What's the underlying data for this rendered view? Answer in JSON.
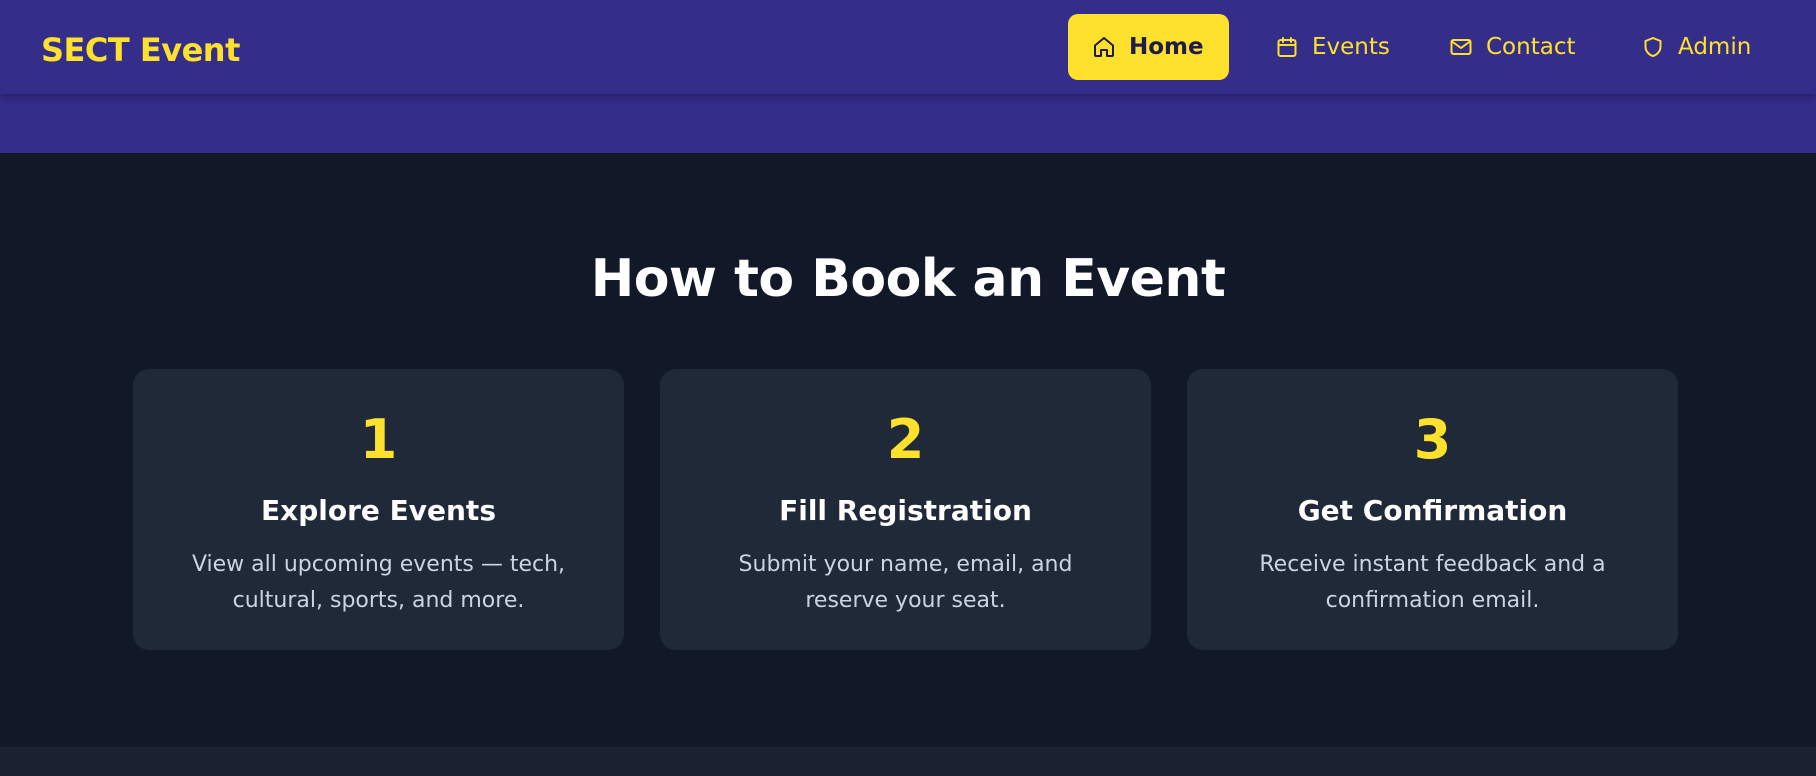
{
  "brand": {
    "name": "SECT Event",
    "color": "#fde12d"
  },
  "nav": {
    "items": [
      {
        "label": "Home",
        "icon": "home-icon",
        "active": true
      },
      {
        "label": "Events",
        "icon": "calendar-icon",
        "active": false
      },
      {
        "label": "Contact",
        "icon": "mail-icon",
        "active": false
      },
      {
        "label": "Admin",
        "icon": "shield-icon",
        "active": false
      }
    ]
  },
  "steps_section": {
    "title": "How to Book an Event",
    "steps": [
      {
        "number": "1",
        "title": "Explore Events",
        "description": "View all upcoming events — tech, cultural, sports, and more."
      },
      {
        "number": "2",
        "title": "Fill Registration",
        "description": "Submit your name, email, and reserve your seat."
      },
      {
        "number": "3",
        "title": "Get Confirmation",
        "description": "Receive instant feedback and a confirmation email."
      }
    ]
  },
  "colors": {
    "navbar": "#352d8a",
    "accent": "#fde12d",
    "background": "#111827",
    "card": "#1f2937"
  }
}
